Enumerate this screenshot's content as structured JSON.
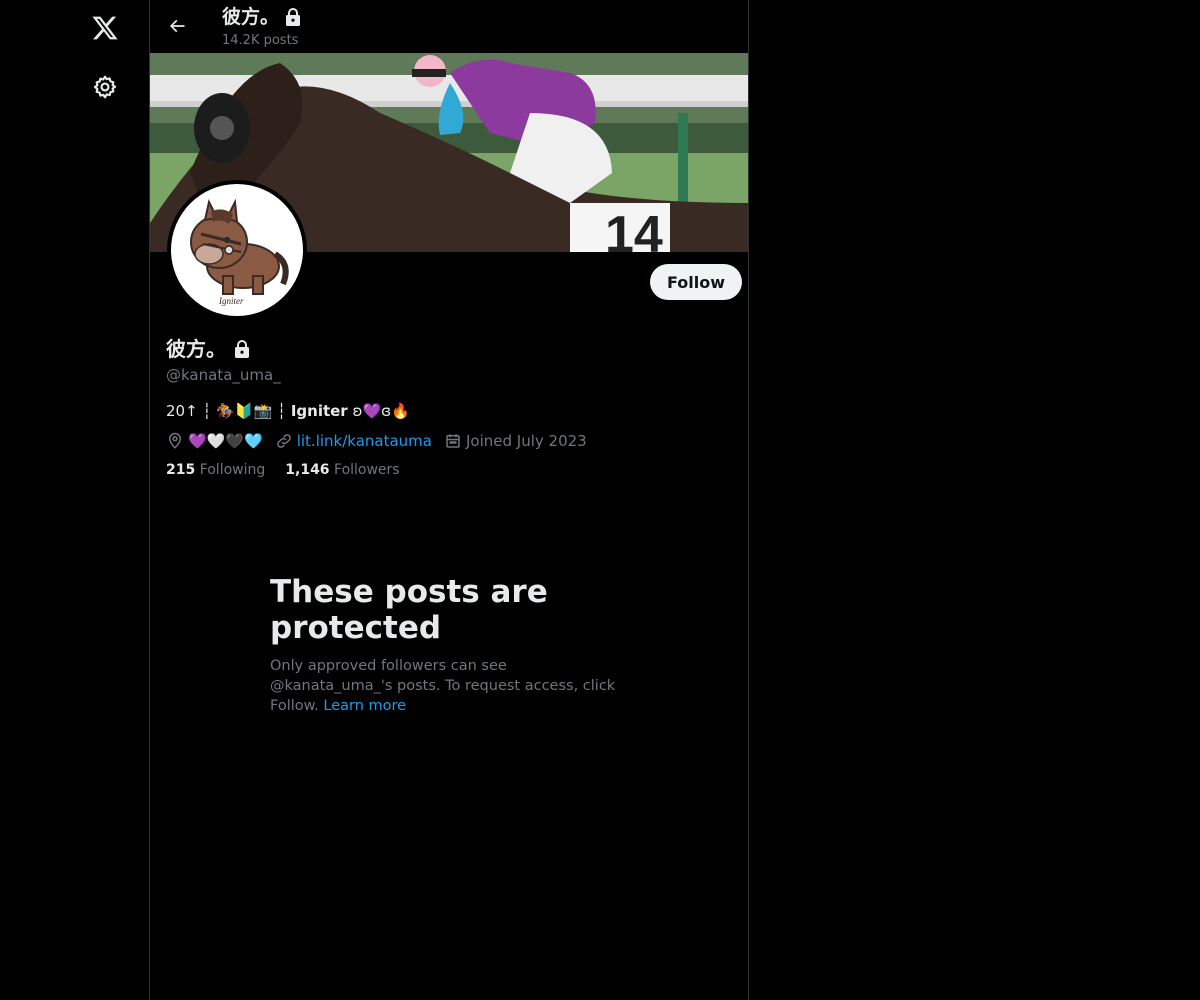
{
  "topbar": {
    "title": "彼方。",
    "posts_count": "14.2K posts"
  },
  "follow_button": {
    "label": "Follow"
  },
  "profile": {
    "display_name": "彼方。",
    "handle": "@kanata_uma_",
    "bio_prefix": "20↑ ┆ 🏇🔰📸 ┆ ",
    "bio_bold": "Igniter",
    "bio_suffix": " ʚ💜ɞ🔥",
    "location": "💜🤍🖤🩵",
    "website": "lit.link/kanatauma",
    "joined": "Joined July 2023",
    "following_count": "215",
    "following_label": "Following",
    "followers_count": "1,146",
    "followers_label": "Followers"
  },
  "protected": {
    "title": "These posts are protected",
    "body": "Only approved followers can see @kanata_uma_'s posts. To request access, click Follow. ",
    "learn_more": "Learn more"
  },
  "avatar_caption": "Igniter",
  "icons": {
    "logo": "x-logo-icon",
    "settings": "gear-icon",
    "back": "arrow-left-icon",
    "lock": "lock-icon",
    "location": "location-pin-icon",
    "link": "link-icon",
    "calendar": "calendar-icon"
  },
  "colors": {
    "background": "#000000",
    "text": "#e7e9ea",
    "secondary": "#71767b",
    "accent": "#1d9bf0",
    "border": "#2f3336",
    "follow_bg": "#eff3f4"
  }
}
